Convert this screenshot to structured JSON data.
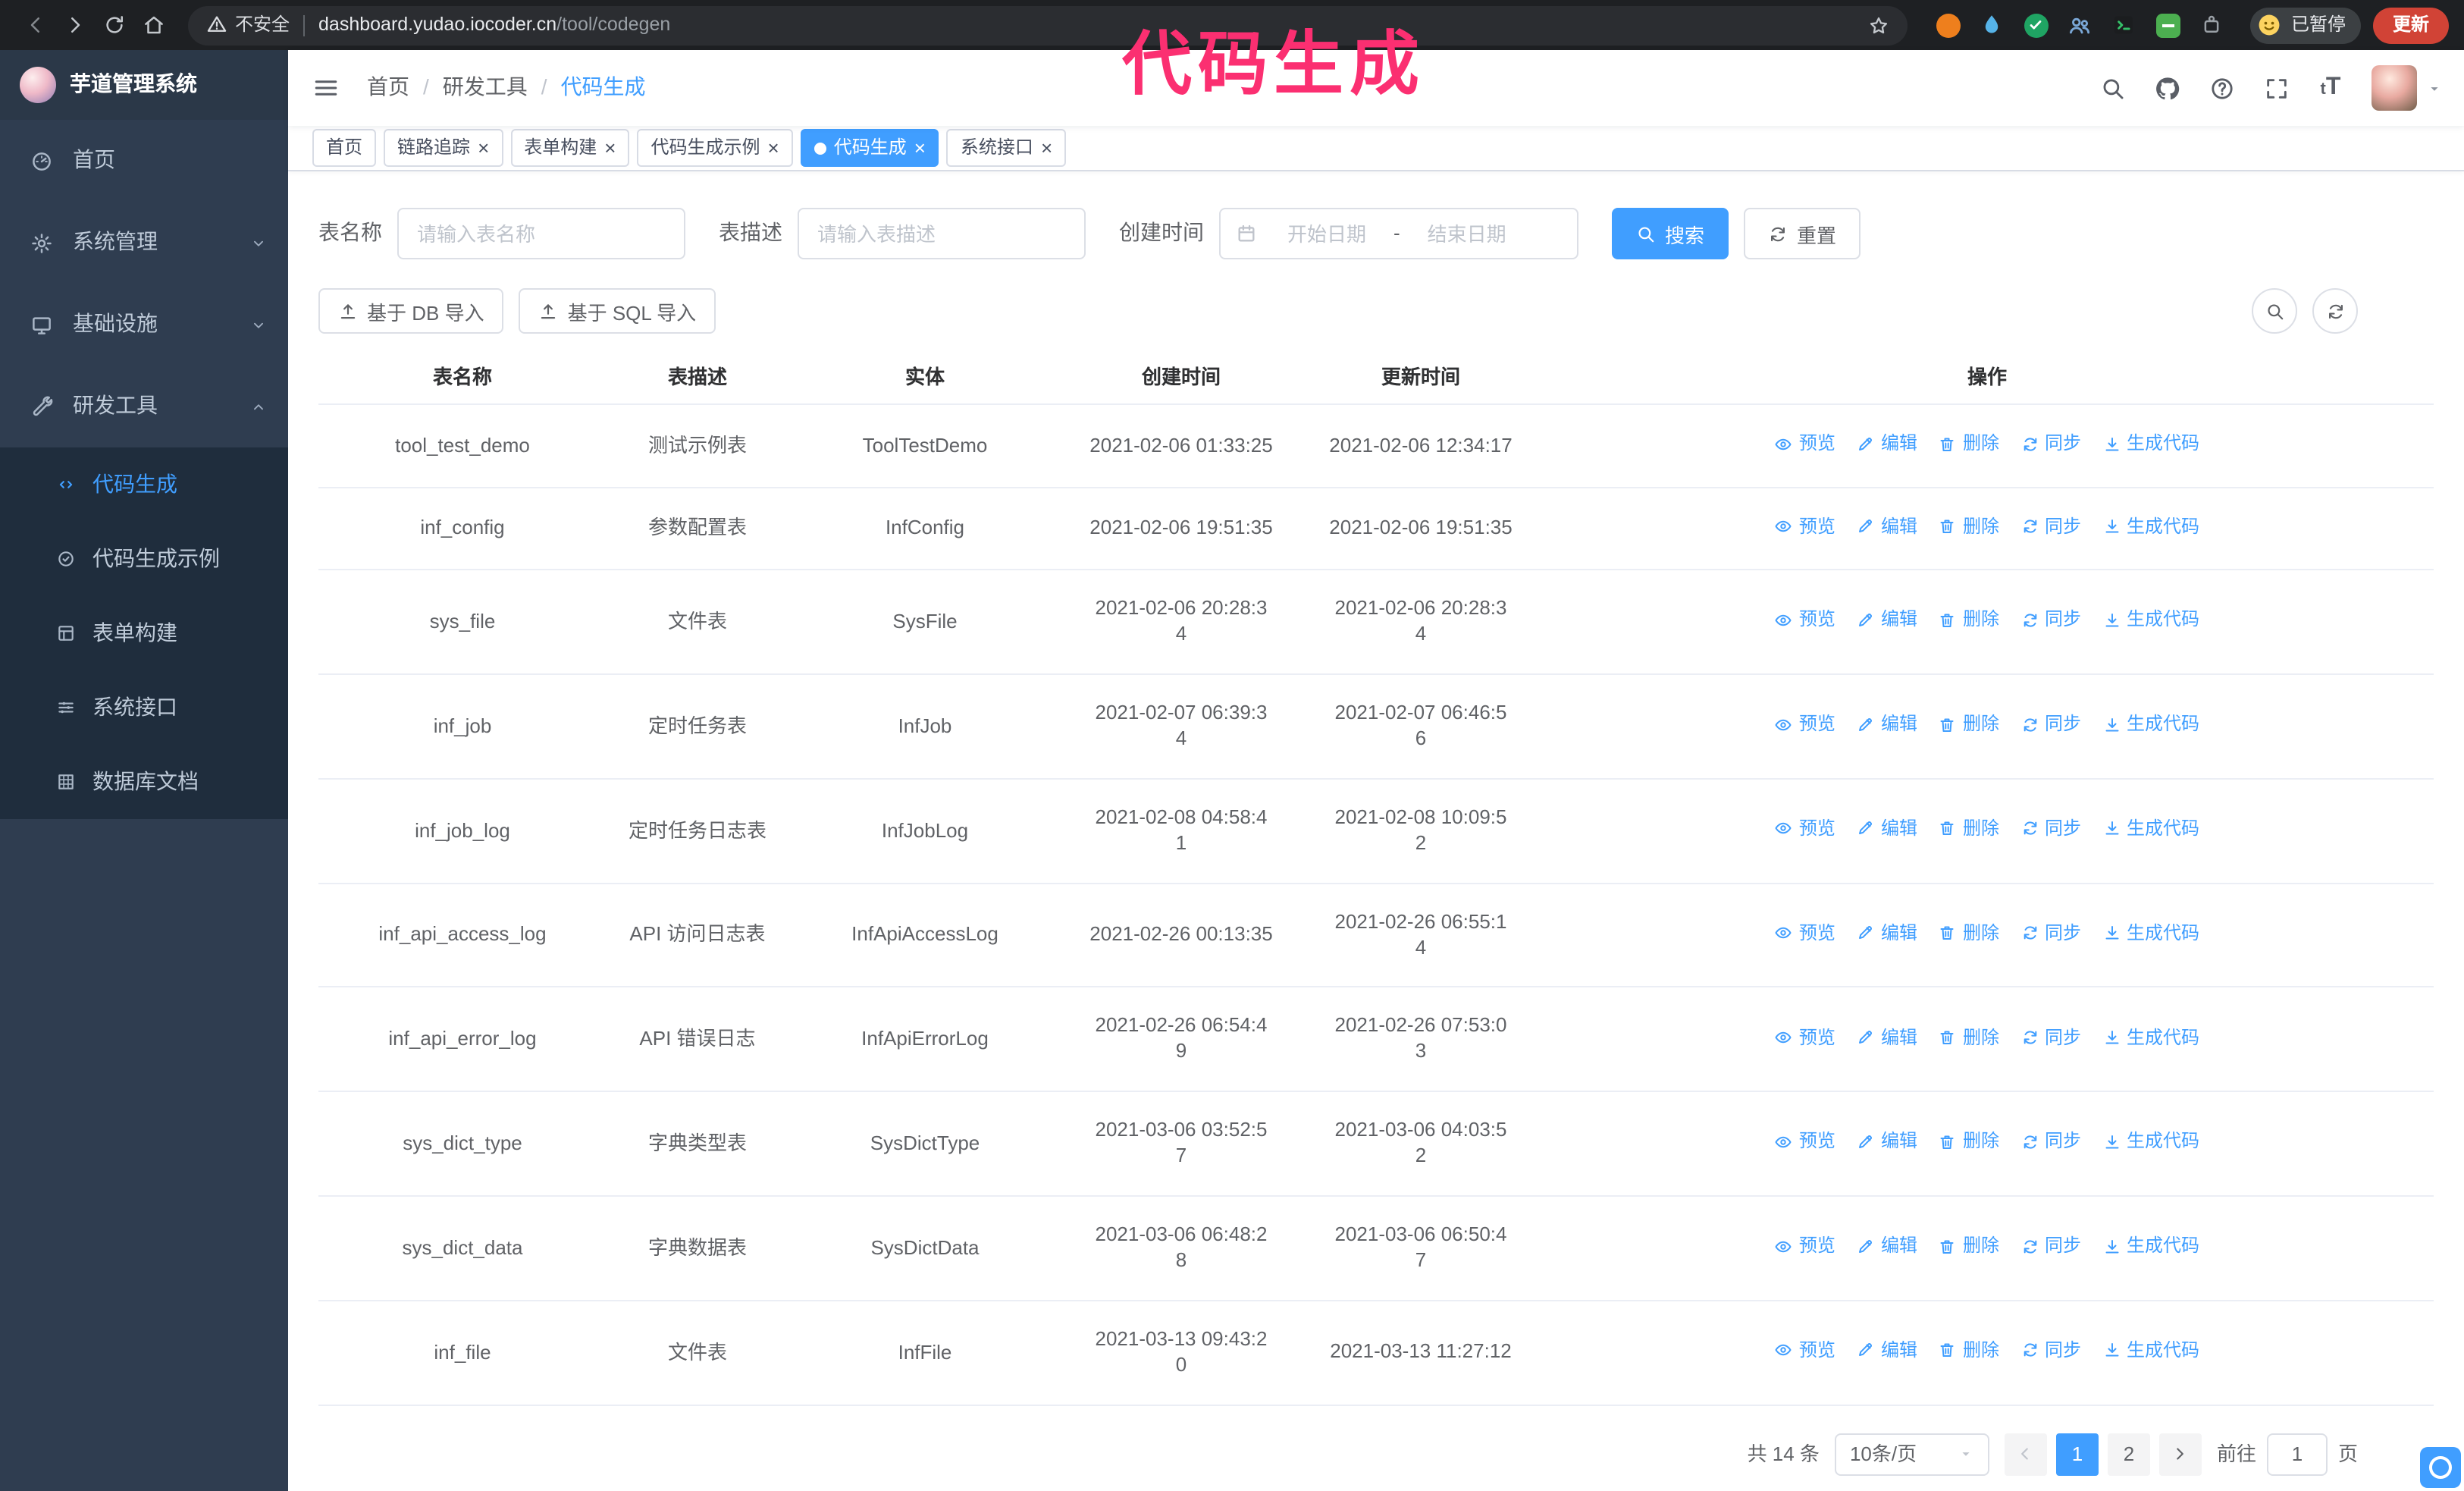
{
  "annotation": {
    "text": "代码生成",
    "color": "#fb2f71"
  },
  "browser": {
    "security_text": "不安全",
    "url_domain": "dashboard.yudao.iocoder.cn",
    "url_path": "/tool/codegen",
    "profile_label": "已暂停",
    "update_label": "更新"
  },
  "sidebar": {
    "logo_title": "芋道管理系统",
    "items": [
      {
        "name": "home",
        "icon": "dashboard",
        "label": "首页"
      },
      {
        "name": "system",
        "icon": "gear",
        "label": "系统管理",
        "expandable": true
      },
      {
        "name": "infra",
        "icon": "monitor",
        "label": "基础设施",
        "expandable": true
      },
      {
        "name": "devtools",
        "icon": "wrench",
        "label": "研发工具",
        "expandable": true,
        "expanded": true,
        "children": [
          {
            "name": "codegen",
            "icon": "code",
            "label": "代码生成",
            "active": true
          },
          {
            "name": "codegen-example",
            "icon": "badge",
            "label": "代码生成示例"
          },
          {
            "name": "form-builder",
            "icon": "form",
            "label": "表单构建"
          },
          {
            "name": "api",
            "icon": "sliders",
            "label": "系统接口"
          },
          {
            "name": "db-doc",
            "icon": "grid",
            "label": "数据库文档"
          }
        ]
      }
    ]
  },
  "header": {
    "breadcrumb": {
      "separator": "/",
      "items": [
        "首页",
        "研发工具",
        "代码生成"
      ]
    }
  },
  "tabs": [
    {
      "name": "home",
      "label": "首页",
      "closable": false,
      "active": false
    },
    {
      "name": "tracer",
      "label": "链路追踪",
      "closable": true,
      "active": false
    },
    {
      "name": "form-builder",
      "label": "表单构建",
      "closable": true,
      "active": false
    },
    {
      "name": "codegen-example",
      "label": "代码生成示例",
      "closable": true,
      "active": false
    },
    {
      "name": "codegen",
      "label": "代码生成",
      "closable": true,
      "active": true
    },
    {
      "name": "api",
      "label": "系统接口",
      "closable": true,
      "active": false
    }
  ],
  "filters": {
    "name_label": "表名称",
    "name_placeholder": "请输入表名称",
    "desc_label": "表描述",
    "desc_placeholder": "请输入表描述",
    "time_label": "创建时间",
    "date_start": "开始日期",
    "date_separator": "-",
    "date_end": "结束日期",
    "search_label": "搜索",
    "reset_label": "重置"
  },
  "toolbar": {
    "import_db": "基于 DB 导入",
    "import_sql": "基于 SQL 导入"
  },
  "table": {
    "columns": [
      "表名称",
      "表描述",
      "实体",
      "创建时间",
      "更新时间",
      "操作"
    ],
    "actions": [
      {
        "name": "preview",
        "icon": "eye",
        "label": "预览"
      },
      {
        "name": "edit",
        "icon": "edit",
        "label": "编辑"
      },
      {
        "name": "delete",
        "icon": "trash",
        "label": "删除"
      },
      {
        "name": "sync",
        "icon": "sync",
        "label": "同步"
      },
      {
        "name": "generate",
        "icon": "download",
        "label": "生成代码"
      }
    ],
    "rows": [
      {
        "name": "tool_test_demo",
        "desc": "测试示例表",
        "entity": "ToolTestDemo",
        "created": "2021-02-06 01:33:25",
        "updated": "2021-02-06 12:34:17"
      },
      {
        "name": "inf_config",
        "desc": "参数配置表",
        "entity": "InfConfig",
        "created": "2021-02-06 19:51:35",
        "updated": "2021-02-06 19:51:35"
      },
      {
        "name": "sys_file",
        "desc": "文件表",
        "entity": "SysFile",
        "created": "2021-02-06 20:28:3\n4",
        "updated": "2021-02-06 20:28:3\n4"
      },
      {
        "name": "inf_job",
        "desc": "定时任务表",
        "entity": "InfJob",
        "created": "2021-02-07 06:39:3\n4",
        "updated": "2021-02-07 06:46:5\n6"
      },
      {
        "name": "inf_job_log",
        "desc": "定时任务日志表",
        "entity": "InfJobLog",
        "created": "2021-02-08 04:58:4\n1",
        "updated": "2021-02-08 10:09:5\n2"
      },
      {
        "name": "inf_api_access_log",
        "desc": "API 访问日志表",
        "entity": "InfApiAccessLog",
        "created": "2021-02-26 00:13:35",
        "updated": "2021-02-26 06:55:1\n4"
      },
      {
        "name": "inf_api_error_log",
        "desc": "API 错误日志",
        "entity": "InfApiErrorLog",
        "created": "2021-02-26 06:54:4\n9",
        "updated": "2021-02-26 07:53:0\n3"
      },
      {
        "name": "sys_dict_type",
        "desc": "字典类型表",
        "entity": "SysDictType",
        "created": "2021-03-06 03:52:5\n7",
        "updated": "2021-03-06 04:03:5\n2"
      },
      {
        "name": "sys_dict_data",
        "desc": "字典数据表",
        "entity": "SysDictData",
        "created": "2021-03-06 06:48:2\n8",
        "updated": "2021-03-06 06:50:4\n7"
      },
      {
        "name": "inf_file",
        "desc": "文件表",
        "entity": "InfFile",
        "created": "2021-03-13 09:43:2\n0",
        "updated": "2021-03-13 11:27:12"
      }
    ]
  },
  "pagination": {
    "total_text": "共 14 条",
    "page_size": "10条/页",
    "pages": [
      "1",
      "2"
    ],
    "active_page": "1",
    "goto_label": "前往",
    "goto_value": "1",
    "goto_suffix": "页"
  },
  "colors": {
    "accent": "#409eff"
  }
}
